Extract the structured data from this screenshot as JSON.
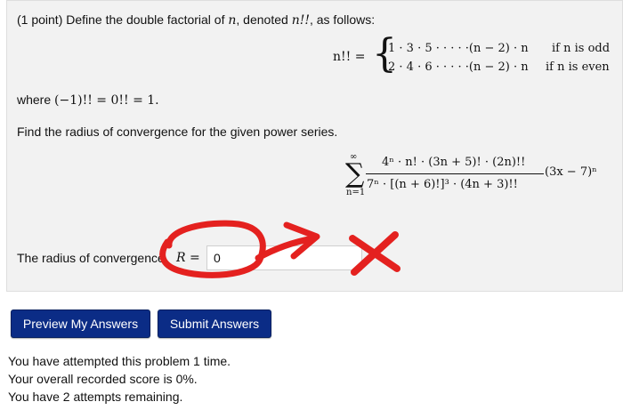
{
  "problem": {
    "intro_points": "(1 point) Define the double factorial of ",
    "intro_var": "n",
    "intro_mid": ", denoted ",
    "intro_notation": "n!!",
    "intro_end": ", as follows:",
    "def_lhs": "n!! =",
    "odd_case_expr": "1 · 3 · 5 · · · · ·(n − 2) · n",
    "odd_case_cond": "if n is odd",
    "even_case_expr": "2 · 4 · 6 · · · · ·(n − 2) · n",
    "even_case_cond": "if n is even",
    "where_text": "where",
    "where_math": "(−1)!! = 0!! = 1.",
    "find_text": "Find the radius of convergence for the given power series.",
    "sum_upper": "∞",
    "sum_symbol": "∑",
    "sum_lower": "n=1",
    "numerator": "4ⁿ · n! · (3n + 5)! · (2n)!!",
    "denominator": "7ⁿ · [(n + 6)!]³ · (4n + 3)!!",
    "power_term": "(3x − 7)ⁿ",
    "radius_label": "The radius of convergence",
    "radius_var": "R =",
    "answer_value": "0"
  },
  "buttons": {
    "preview_label": "Preview My Answers",
    "submit_label": "Submit Answers"
  },
  "status": {
    "line1": "You have attempted this problem 1 time.",
    "line2": "Your overall recorded score is 0%.",
    "line3": "You have 2 attempts remaining."
  },
  "colors": {
    "button_bg": "#0b2c86",
    "annotation_red": "#e4211f",
    "panel_bg": "#f2f2f2"
  }
}
